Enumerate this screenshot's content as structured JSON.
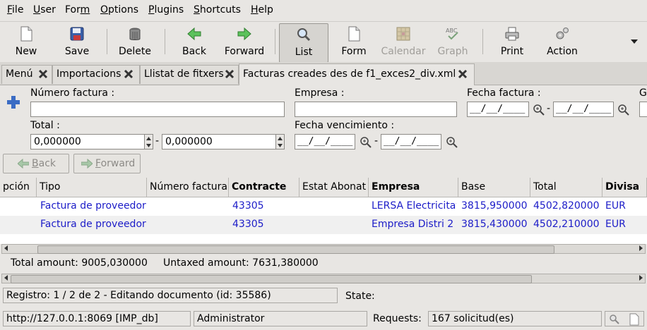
{
  "menubar": {
    "items": [
      {
        "pre": "",
        "u": "F",
        "post": "ile"
      },
      {
        "pre": "",
        "u": "U",
        "post": "ser"
      },
      {
        "pre": "For",
        "u": "m",
        "post": ""
      },
      {
        "pre": "",
        "u": "O",
        "post": "ptions"
      },
      {
        "pre": "",
        "u": "P",
        "post": "lugins"
      },
      {
        "pre": "",
        "u": "S",
        "post": "hortcuts"
      },
      {
        "pre": "",
        "u": "H",
        "post": "elp"
      }
    ]
  },
  "toolbar": {
    "new": "New",
    "save": "Save",
    "delete": "Delete",
    "back": "Back",
    "forward": "Forward",
    "list": "List",
    "form": "Form",
    "calendar": "Calendar",
    "graph": "Graph",
    "print": "Print",
    "action": "Action",
    "graph_icon_text": "ABC"
  },
  "tabs": [
    {
      "label": "Menú"
    },
    {
      "label": "Importacions"
    },
    {
      "label": "Llistat de fitxers"
    },
    {
      "label": "Facturas creades des de f1_exces2_div.xml"
    }
  ],
  "search": {
    "numero_factura_label": "Número factura :",
    "numero_factura_value": "",
    "empresa_label": "Empresa :",
    "empresa_value": "",
    "fecha_factura_label": "Fecha factura :",
    "date_mask": "__/__/____",
    "date_sep": "-",
    "cut_label": "G",
    "total_label": "Total :",
    "total_from": "0,000000",
    "total_to": "0,000000",
    "fecha_vencimiento_label": "Fecha vencimiento :",
    "back": "Back",
    "forward": "Forward",
    "back_u": "B",
    "back_rest": "ack",
    "forward_u": "F",
    "forward_rest": "orward"
  },
  "table": {
    "columns": [
      "pción",
      "Tipo",
      "Número factura",
      "Contracte",
      "Estat Abonat",
      "Empresa",
      "Base",
      "Total",
      "Divisa"
    ],
    "rows": [
      {
        "tipo": "Factura de proveedor",
        "numero": "",
        "contracte": "43305",
        "estat": "",
        "empresa": "LERSA Electricitat",
        "base": "3815,950000",
        "total": "4502,820000",
        "divisa": "EUR"
      },
      {
        "tipo": "Factura de proveedor",
        "numero": "",
        "contracte": "43305",
        "estat": "",
        "empresa": "Empresa Distri 2",
        "base": "3815,430000",
        "total": "4502,210000",
        "divisa": "EUR"
      }
    ]
  },
  "totals": {
    "total_amount": "Total amount: 9005,030000",
    "untaxed_amount": "Untaxed amount: 7631,380000"
  },
  "status": {
    "registro": "Registro: 1 / 2 de 2 - Editando documento (id: 35586)",
    "state_label": "State:"
  },
  "footer": {
    "server": "http://127.0.0.1:8069 [IMP_db]",
    "user": "Administrator",
    "requests_label": "Requests:",
    "requests_value": "167 solicitud(es)"
  },
  "colors": {
    "link_text": "#1c1cc8",
    "window_bg": "#e8e6e3",
    "new_icon_blue": "#3b6cc4",
    "arrow_green": "#3aa83a"
  }
}
